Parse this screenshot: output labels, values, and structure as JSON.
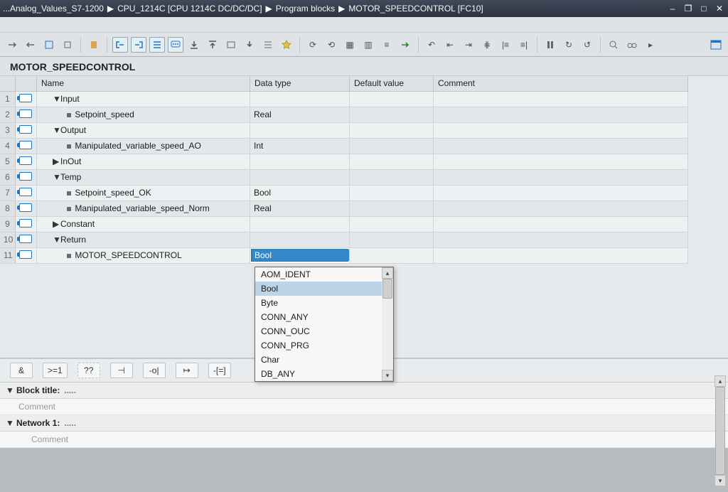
{
  "titlebar": {
    "crumbs": [
      "...Analog_Values_S7-1200",
      "CPU_1214C [CPU 1214C DC/DC/DC]",
      "Program blocks",
      "MOTOR_SPEEDCONTROL [FC10]"
    ]
  },
  "block": {
    "name": "MOTOR_SPEEDCONTROL"
  },
  "columns": {
    "name": "Name",
    "datatype": "Data type",
    "default": "Default value",
    "comment": "Comment"
  },
  "rows": [
    {
      "num": "1",
      "kind": "section",
      "exp": "▼",
      "name": "Input"
    },
    {
      "num": "2",
      "kind": "var",
      "name": "Setpoint_speed",
      "type": "Real"
    },
    {
      "num": "3",
      "kind": "section",
      "exp": "▼",
      "name": "Output"
    },
    {
      "num": "4",
      "kind": "var",
      "name": "Manipulated_variable_speed_AO",
      "type": "Int"
    },
    {
      "num": "5",
      "kind": "section",
      "exp": "▶",
      "name": "InOut"
    },
    {
      "num": "6",
      "kind": "section",
      "exp": "▼",
      "name": "Temp"
    },
    {
      "num": "7",
      "kind": "var",
      "name": "Setpoint_speed_OK",
      "type": "Bool"
    },
    {
      "num": "8",
      "kind": "var",
      "name": "Manipulated_variable_speed_Norm",
      "type": "Real"
    },
    {
      "num": "9",
      "kind": "section",
      "exp": "▶",
      "name": "Constant"
    },
    {
      "num": "10",
      "kind": "section",
      "exp": "▼",
      "name": "Return"
    },
    {
      "num": "11",
      "kind": "editvar",
      "name": "MOTOR_SPEEDCONTROL",
      "type": "Bool"
    }
  ],
  "dropdown": {
    "items": [
      "AOM_IDENT",
      "Bool",
      "Byte",
      "CONN_ANY",
      "CONN_OUC",
      "CONN_PRG",
      "Char",
      "DB_ANY"
    ],
    "selected": "Bool"
  },
  "palette": {
    "items": [
      "&",
      ">=1",
      "??",
      "⊣",
      "-o|",
      "↦",
      "-[=]"
    ]
  },
  "sections": {
    "block_title_label": "Block title:",
    "network1_label": "Network 1:",
    "comment_placeholder": "Comment"
  }
}
